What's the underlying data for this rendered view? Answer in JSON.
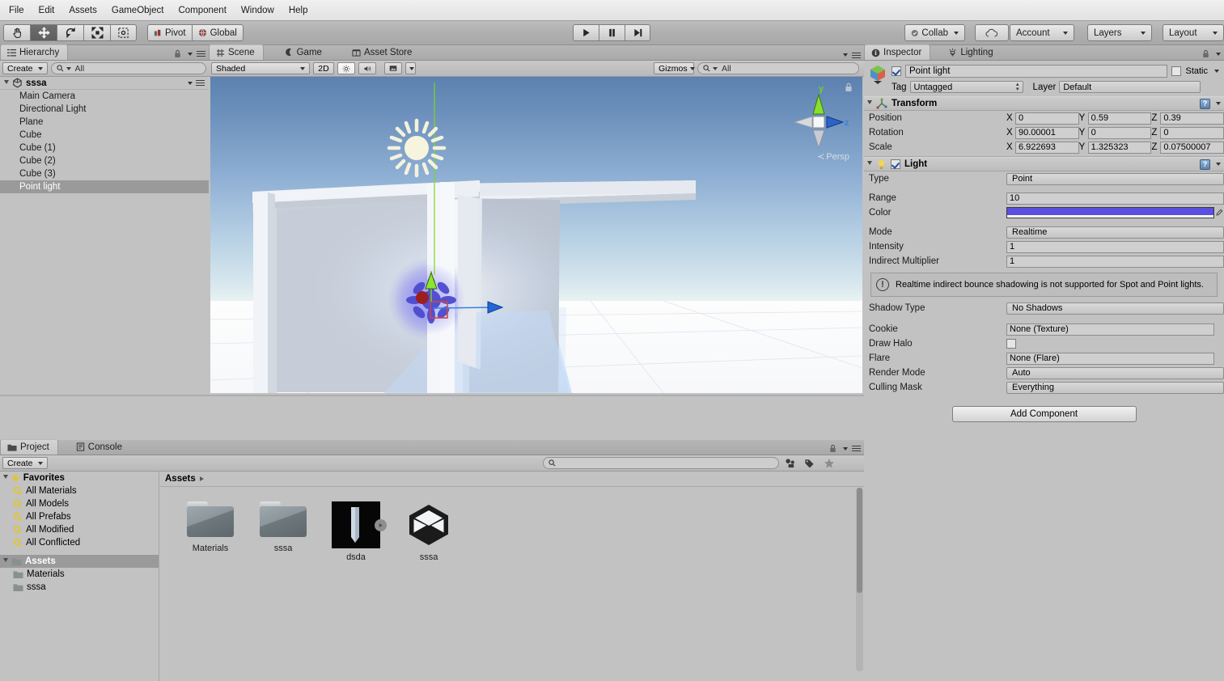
{
  "menubar": {
    "items": [
      "File",
      "Edit",
      "Assets",
      "GameObject",
      "Component",
      "Window",
      "Help"
    ]
  },
  "toolbar": {
    "tools": [
      {
        "name": "hand-tool",
        "label": "Hand",
        "active": false
      },
      {
        "name": "move-tool",
        "label": "Move",
        "active": true
      },
      {
        "name": "rotate-tool",
        "label": "Rotate",
        "active": false
      },
      {
        "name": "scale-tool",
        "label": "Scale",
        "active": false
      },
      {
        "name": "rect-tool",
        "label": "Rect",
        "active": false
      }
    ],
    "pivot_label": "Pivot",
    "global_label": "Global",
    "play_label": "Play",
    "pause_label": "Pause",
    "step_label": "Step",
    "collab_label": "Collab",
    "cloud_label": "Cloud",
    "account_label": "Account",
    "layers_label": "Layers",
    "layout_label": "Layout"
  },
  "hierarchy": {
    "tab_label": "Hierarchy",
    "create_label": "Create",
    "search_placeholder": "All",
    "scene_name": "sssa",
    "items": [
      {
        "label": "Main Camera",
        "selected": false
      },
      {
        "label": "Directional Light",
        "selected": false
      },
      {
        "label": "Plane",
        "selected": false
      },
      {
        "label": "Cube",
        "selected": false
      },
      {
        "label": "Cube (1)",
        "selected": false
      },
      {
        "label": "Cube (2)",
        "selected": false
      },
      {
        "label": "Cube (3)",
        "selected": false
      },
      {
        "label": "Point light",
        "selected": true
      }
    ]
  },
  "scene": {
    "tabs": [
      {
        "label": "Scene",
        "active": true
      },
      {
        "label": "Game",
        "active": false
      },
      {
        "label": "Asset Store",
        "active": false
      }
    ],
    "draw_mode": "Shaded",
    "mode_2d": "2D",
    "gizmos_label": "Gizmos",
    "search_placeholder": "All",
    "axis_y": "y",
    "axis_z": "z",
    "persp_label": "Persp"
  },
  "inspector": {
    "tabs": [
      {
        "label": "Inspector",
        "active": true
      },
      {
        "label": "Lighting",
        "active": false
      }
    ],
    "object_name": "Point light",
    "object_enabled": true,
    "static_label": "Static",
    "static_checked": false,
    "tag_label": "Tag",
    "tag_value": "Untagged",
    "layer_label": "Layer",
    "layer_value": "Default",
    "transform": {
      "title": "Transform",
      "rows": [
        {
          "label": "Position",
          "x": "0",
          "y": "0.59",
          "z": "0.39"
        },
        {
          "label": "Rotation",
          "x": "90.00001",
          "y": "0",
          "z": "0"
        },
        {
          "label": "Scale",
          "x": "6.922693",
          "y": "1.325323",
          "z": "0.07500007"
        }
      ],
      "axis_labels": [
        "X",
        "Y",
        "Z"
      ]
    },
    "light": {
      "title": "Light",
      "enabled": true,
      "type_label": "Type",
      "type_value": "Point",
      "range_label": "Range",
      "range_value": "10",
      "color_label": "Color",
      "color_value": "#5a4fe0",
      "mode_label": "Mode",
      "mode_value": "Realtime",
      "intensity_label": "Intensity",
      "intensity_value": "1",
      "indirect_label": "Indirect Multiplier",
      "indirect_value": "1",
      "warning": "Realtime indirect bounce shadowing is not supported for Spot and Point lights.",
      "shadow_type_label": "Shadow Type",
      "shadow_type_value": "No Shadows",
      "cookie_label": "Cookie",
      "cookie_value": "None (Texture)",
      "draw_halo_label": "Draw Halo",
      "draw_halo_checked": false,
      "flare_label": "Flare",
      "flare_value": "None (Flare)",
      "render_mode_label": "Render Mode",
      "render_mode_value": "Auto",
      "culling_mask_label": "Culling Mask",
      "culling_mask_value": "Everything"
    },
    "add_component_label": "Add Component"
  },
  "project": {
    "tabs": [
      {
        "label": "Project",
        "active": true
      },
      {
        "label": "Console",
        "active": false
      }
    ],
    "create_label": "Create",
    "search_placeholder": "",
    "favorites_label": "Favorites",
    "favorites": [
      "All Materials",
      "All Models",
      "All Prefabs",
      "All Modified",
      "All Conflicted"
    ],
    "assets_label": "Assets",
    "assets_children": [
      "Materials",
      "sssa"
    ],
    "breadcrumb": "Assets",
    "grid_items": [
      {
        "label": "Materials",
        "kind": "folder"
      },
      {
        "label": "sssa",
        "kind": "folder"
      },
      {
        "label": "dsda",
        "kind": "model-preview"
      },
      {
        "label": "sssa",
        "kind": "unity-asset"
      }
    ]
  }
}
